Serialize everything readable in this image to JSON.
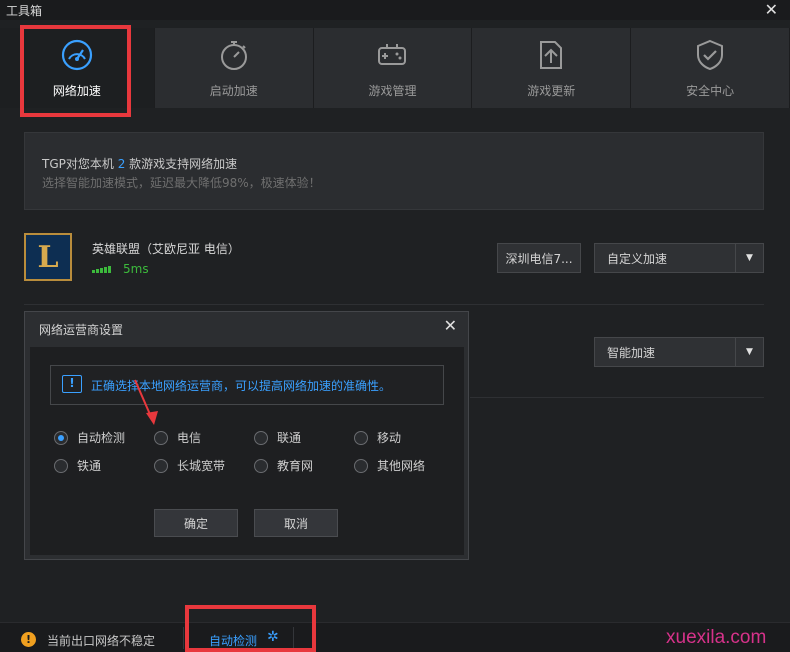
{
  "window": {
    "title": "工具箱",
    "close_glyph": "✕"
  },
  "tabs": [
    {
      "label": "网络加速",
      "icon": "speedometer-icon",
      "active": true
    },
    {
      "label": "启动加速",
      "icon": "stopwatch-icon",
      "active": false
    },
    {
      "label": "游戏管理",
      "icon": "gamepad-icon",
      "active": false
    },
    {
      "label": "游戏更新",
      "icon": "upload-icon",
      "active": false
    },
    {
      "label": "安全中心",
      "icon": "shield-check-icon",
      "active": false
    }
  ],
  "banner": {
    "line1_prefix": "TGP对您本机 ",
    "line1_count": "2",
    "line1_suffix": " 款游戏支持网络加速",
    "line2": "选择智能加速模式，延迟最大降低98%，极速体验！"
  },
  "game": {
    "name": "英雄联盟（艾欧尼亚 电信）",
    "ping": "5ms",
    "icon_letter": "L",
    "server_button": "深圳电信7...",
    "mode_select": "自定义加速"
  },
  "game2": {
    "mode_select": "智能加速"
  },
  "dialog": {
    "title": "网络运营商设置",
    "notice": "正确选择本地网络运营商，可以提高网络加速的准确性。",
    "options": [
      {
        "label": "自动检测",
        "checked": true
      },
      {
        "label": "电信",
        "checked": false
      },
      {
        "label": "联通",
        "checked": false
      },
      {
        "label": "移动",
        "checked": false
      },
      {
        "label": "铁通",
        "checked": false
      },
      {
        "label": "长城宽带",
        "checked": false
      },
      {
        "label": "教育网",
        "checked": false
      },
      {
        "label": "其他网络",
        "checked": false
      }
    ],
    "ok_label": "确定",
    "cancel_label": "取消"
  },
  "status": {
    "warning_text": "当前出口网络不稳定",
    "auto_detect": "自动检测",
    "watermark": "xuexila.com"
  },
  "colors": {
    "accent": "#3aa0ff",
    "highlight_box": "#e8383d",
    "ping_green": "#3cba3c",
    "warning": "#f0a020"
  }
}
